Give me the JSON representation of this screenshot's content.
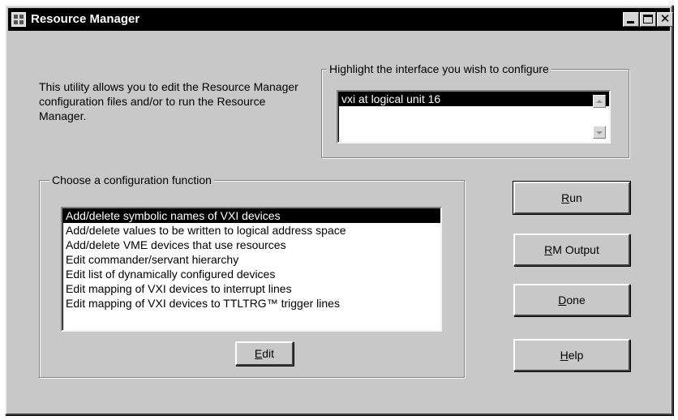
{
  "window": {
    "title": "Resource Manager"
  },
  "description": "This utility allows you to edit the Resource Manager configuration files and/or to run the Resource Manager.",
  "interface_group": {
    "label": "Highlight the interface you wish to configure",
    "items": [
      {
        "label": "vxi at logical unit 16",
        "selected": true
      }
    ]
  },
  "config_group": {
    "label": "Choose a configuration function",
    "items": [
      {
        "label": "Add/delete symbolic names of VXI devices",
        "selected": true
      },
      {
        "label": "Add/delete values to be written to logical address space",
        "selected": false
      },
      {
        "label": "Add/delete VME devices that use resources",
        "selected": false
      },
      {
        "label": "Edit commander/servant hierarchy",
        "selected": false
      },
      {
        "label": "Edit list of dynamically configured devices",
        "selected": false
      },
      {
        "label": "Edit mapping of VXI devices to interrupt lines",
        "selected": false
      },
      {
        "label": "Edit mapping of VXI devices to TTLTRG™ trigger lines",
        "selected": false
      }
    ],
    "edit_button": {
      "mnemonic": "E",
      "rest": "dit"
    }
  },
  "buttons": {
    "run": {
      "mnemonic": "R",
      "rest": "un"
    },
    "rm_output": {
      "mnemonic": "R",
      "rest": "M Output"
    },
    "done": {
      "mnemonic": "D",
      "rest": "one"
    },
    "help": {
      "mnemonic": "H",
      "rest": "elp"
    }
  },
  "icons": {
    "app": "grid-app-icon",
    "minimize": "minimize-icon",
    "maximize": "maximize-icon",
    "close": "close-icon",
    "scroll_up": "scroll-up-arrow-icon",
    "scroll_down": "scroll-down-arrow-icon"
  },
  "colors": {
    "titlebar": "#000000",
    "window_face": "#c8c8c8",
    "selection": "#000000",
    "list_background": "#ffffff"
  }
}
